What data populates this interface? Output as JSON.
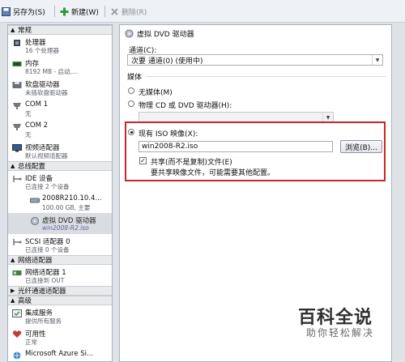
{
  "toolbar": {
    "save_as": "另存为(S)",
    "new": "新建(W)",
    "delete": "删除(R)"
  },
  "sidebar": {
    "cat_general": "常规",
    "cat_controllers": "总线配置",
    "cat_network": "网络适配器",
    "cat_fc": "光纤通道适配器",
    "cat_advanced": "高级",
    "items": [
      {
        "title": "处理器",
        "sub": "16 个处理器"
      },
      {
        "title": "内存",
        "sub": "8192 MB - 启动,..."
      },
      {
        "title": "软盘驱动器",
        "sub": "未插软盘驱动器"
      },
      {
        "title": "COM 1",
        "sub": "无"
      },
      {
        "title": "COM 2",
        "sub": "无"
      },
      {
        "title": "视频适配器",
        "sub": "默认视频适配器"
      },
      {
        "title": "IDE 设备",
        "sub": "已连接 2 个设备"
      },
      {
        "title": "2008R210.10.4...",
        "sub": "100.00 GB, 主要"
      },
      {
        "title": "虚拟 DVD 驱动器",
        "sub": "win2008-R2.iso"
      },
      {
        "title": "SCSI 适配器 0",
        "sub": "已连接 0 个设备"
      },
      {
        "title": "网络适配器 1",
        "sub": "已连接到 OUT"
      },
      {
        "title": "集成服务",
        "sub": "提供所有服务"
      },
      {
        "title": "可用性",
        "sub": "正常"
      },
      {
        "title": "Microsoft Azure Si..."
      }
    ]
  },
  "panel": {
    "header": "虚拟 DVD 驱动器",
    "channel_label": "通道(C):",
    "channel_value": "次要 通道(0) (使用中)",
    "media_label": "媒体",
    "opt_none": "无媒体(M)",
    "opt_physical": "物理 CD 或 DVD 驱动器(H):",
    "opt_iso": "现有 ISO 映像(X):",
    "iso_path": "win2008-R2.iso",
    "browse": "浏览(B)...",
    "share_label": "共享(而不是复制)文件(E)",
    "share_note": "要共享映像文件，可能需要其他配置。"
  },
  "watermark": {
    "brand": "百科全说",
    "slogan": "助你轻松解决"
  }
}
